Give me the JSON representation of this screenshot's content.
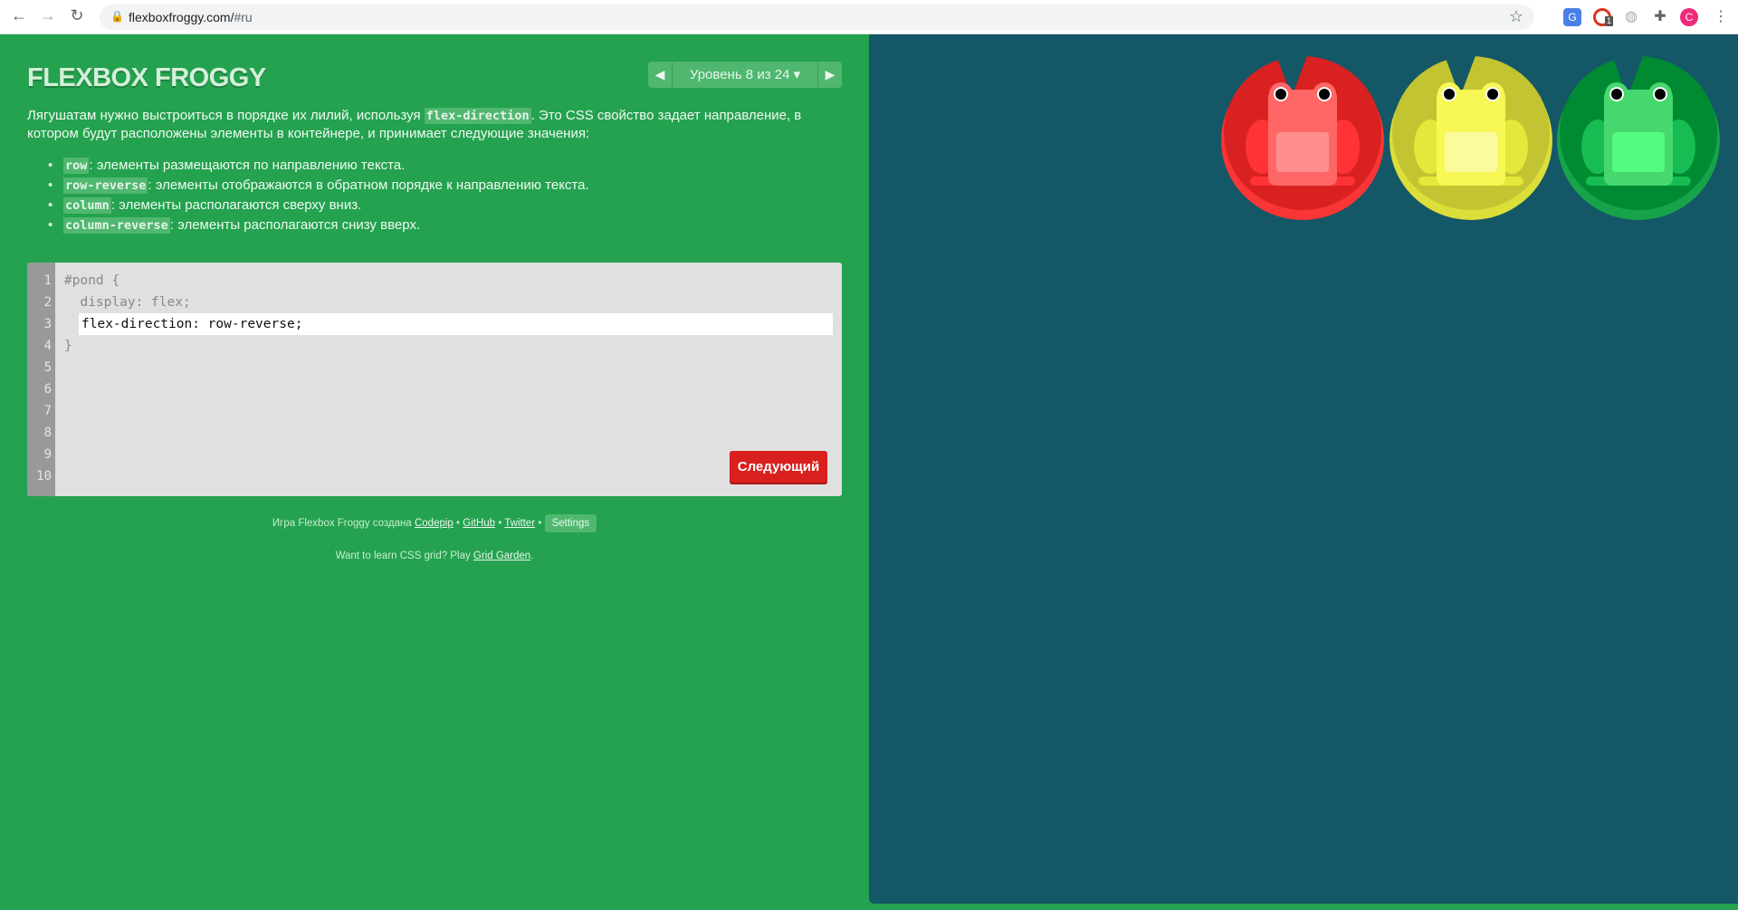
{
  "browser": {
    "url_host": "flexboxfroggy.com/",
    "url_hash": "#ru",
    "extension_badge": "1",
    "profile_initial": "C"
  },
  "header": {
    "title": "FLEXBOX FROGGY",
    "level_label": "Уровень 8 из 24 ▾"
  },
  "instructions": {
    "pre": "Лягушатам нужно выстроиться в порядке их лилий, используя ",
    "property": "flex-direction",
    "post": ". Это CSS свойство задает направление, в котором будут расположены элементы в контейнере, и принимает следующие значения:",
    "values": [
      {
        "code": "row",
        "text": ": элементы размещаются по направлению текста."
      },
      {
        "code": "row-reverse",
        "text": ": элементы отображаются в обратном порядке к направлению текста."
      },
      {
        "code": "column",
        "text": ": элементы располагаются сверху вниз."
      },
      {
        "code": "column-reverse",
        "text": ": элементы располагаются снизу вверх."
      }
    ]
  },
  "editor": {
    "line_numbers": [
      "1",
      "2",
      "3",
      "4",
      "5",
      "6",
      "7",
      "8",
      "9",
      "10"
    ],
    "line1": "#pond {",
    "line2": "  display: flex;",
    "input_value": "flex-direction: row-reverse;",
    "line4": "}",
    "next_label": "Следующий"
  },
  "footer": {
    "credit": "Игра Flexbox Froggy создана ",
    "codepip": "Codepip",
    "sep": " • ",
    "github": "GitHub",
    "twitter": "Twitter",
    "settings": "Settings",
    "grid_pre": "Want to learn CSS grid? Play ",
    "grid_link": "Grid Garden",
    "grid_post": "."
  },
  "pond": {
    "lilypads": [
      {
        "color": "red",
        "hex": "#d92121"
      },
      {
        "color": "yellow",
        "hex": "#c3c431"
      },
      {
        "color": "green",
        "hex": "#008a31"
      }
    ],
    "frogs": [
      {
        "color": "red",
        "hex": "#ff6767"
      },
      {
        "color": "yellow",
        "hex": "#f7f756"
      },
      {
        "color": "green",
        "hex": "#46d86f"
      }
    ]
  }
}
